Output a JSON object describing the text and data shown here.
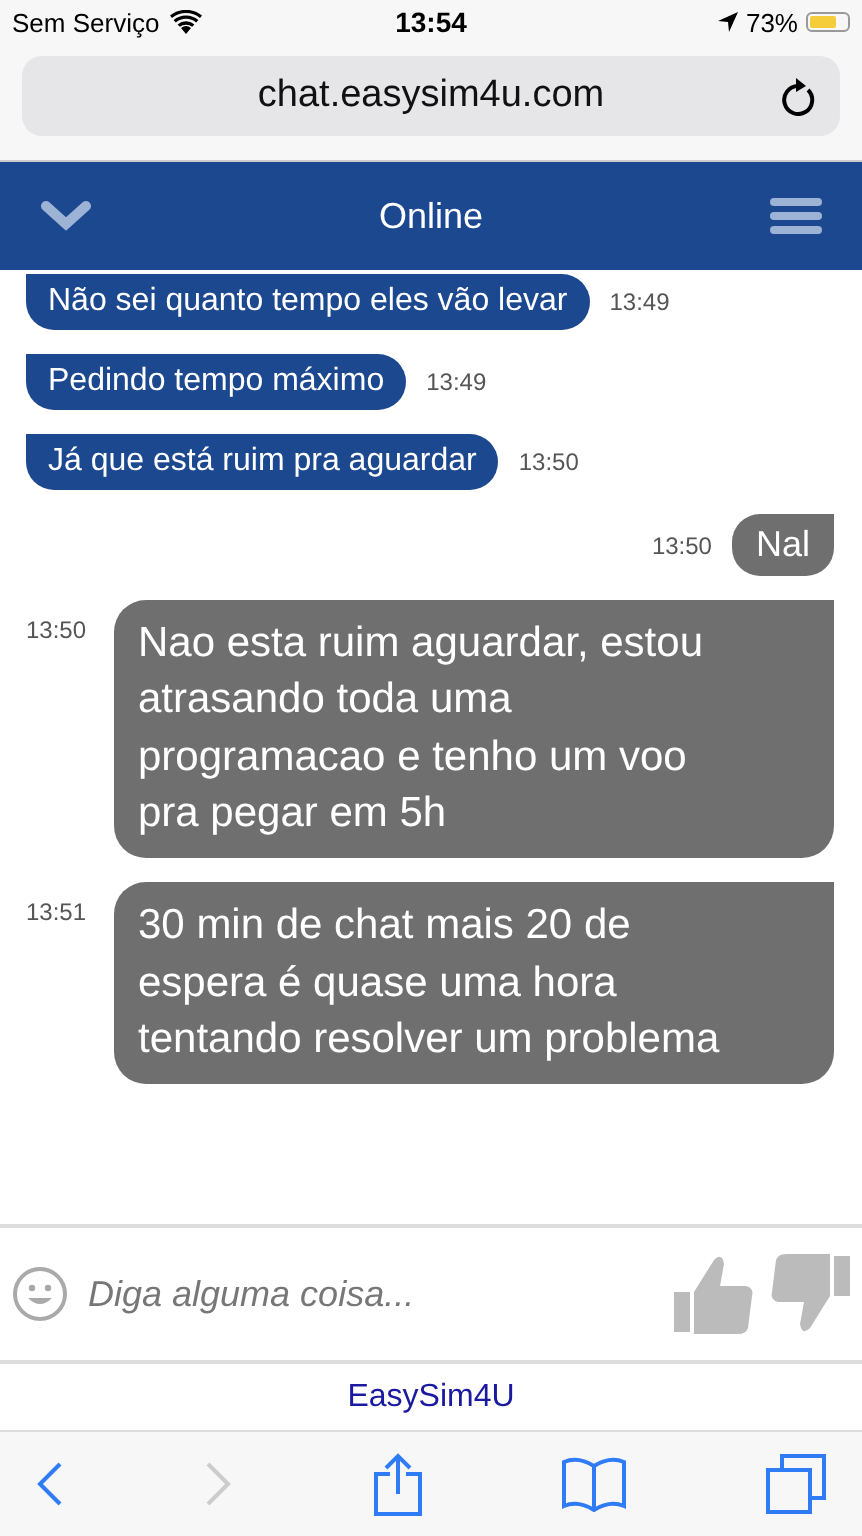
{
  "status_bar": {
    "carrier": "Sem Serviço",
    "time": "13:54",
    "battery": "73%"
  },
  "address_bar": {
    "url": "chat.easysim4u.com"
  },
  "header": {
    "title": "Online"
  },
  "messages": [
    {
      "kind": "agent",
      "text": "Não sei quanto tempo eles vão levar",
      "time": "13:49"
    },
    {
      "kind": "agent",
      "text": "Pedindo tempo máximo",
      "time": "13:49"
    },
    {
      "kind": "agent",
      "text": "Já que está ruim pra aguardar",
      "time": "13:50"
    },
    {
      "kind": "user",
      "text": "Nal",
      "time": "13:50"
    },
    {
      "kind": "user-long",
      "text": "Nao esta ruim aguardar, estou atrasando toda uma programacao e tenho um voo pra pegar em 5h",
      "time": "13:50"
    },
    {
      "kind": "user-long",
      "text": "30 min de chat mais 20 de espera é quase uma hora tentando resolver um problema",
      "time": "13:51"
    }
  ],
  "composer": {
    "placeholder": "Diga alguma coisa..."
  },
  "footer": {
    "brand": "EasySim4U"
  }
}
